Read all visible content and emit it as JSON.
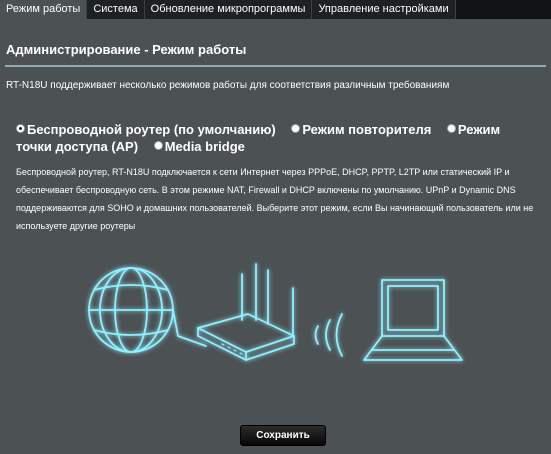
{
  "tabs": [
    {
      "label": "Режим работы",
      "active": true
    },
    {
      "label": "Система",
      "active": false
    },
    {
      "label": "Обновление микропрограммы",
      "active": false
    },
    {
      "label": "Управление настройками",
      "active": false
    }
  ],
  "page_title": "Администрирование - Режим работы",
  "description": "RT-N18U поддерживает несколько режимов работы для соответствия различным требованиям",
  "modes": [
    {
      "label": "Беспроводной роутер (по умолчанию)",
      "selected": true
    },
    {
      "label": "Режим повторителя",
      "selected": false
    },
    {
      "label": "Режим точки доступа (AP)",
      "selected": false
    },
    {
      "label": "Media bridge",
      "selected": false
    }
  ],
  "mode_description": "Беспроводной роутер, RT-N18U подключается к сети Интернет через PPPoE, DHCP, PPTP, L2TP или статический IP и обеспечивает беспроводную сеть. В этом режиме NAT, Firewall и DHCP включены по умолчанию. UPnP и Dynamic DNS поддерживаются для SOHO и домашних пользователей. Выберите этот режим, если Вы начинающий пользователь или не используете другие роутеры",
  "illustration_icons": [
    "globe-icon",
    "router-icon",
    "wifi-signal-icon",
    "laptop-icon"
  ],
  "save_label": "Сохранить",
  "colors": {
    "background": "#4c5154",
    "tab_bar": "#111415",
    "glow": "#8ff0ff",
    "button": "#111111"
  }
}
